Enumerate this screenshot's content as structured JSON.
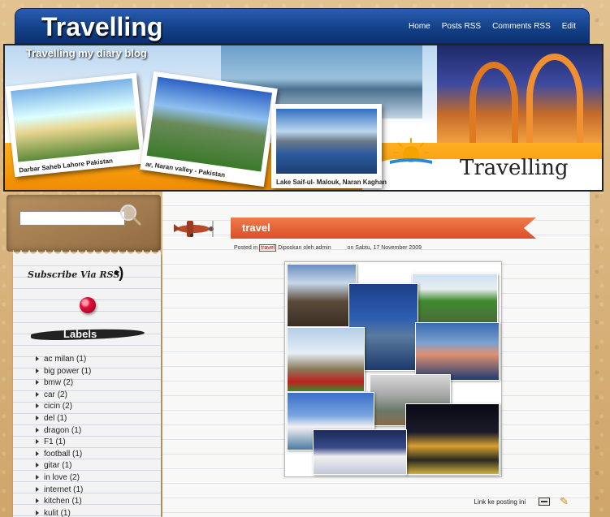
{
  "header": {
    "site_title": "Travelling",
    "nav": [
      "Home",
      "Posts RSS",
      "Comments RSS",
      "Edit"
    ]
  },
  "banner": {
    "tagline": "Travelling my diary blog",
    "word": "Travelling",
    "captions": [
      "Darbar Saheb Lahore Pakistan",
      "ar, Naran valley - Pakistan",
      "Lake Saif-ul- Malouk, Naran Kaghan"
    ]
  },
  "sidebar": {
    "search_value": "",
    "subscribe_text": "Subscribe Via RSS",
    "labels_title": "Labels",
    "labels": [
      {
        "name": "ac milan",
        "count": "(1)"
      },
      {
        "name": "big power",
        "count": "(1)"
      },
      {
        "name": "bmw",
        "count": "(2)"
      },
      {
        "name": "car",
        "count": "(2)"
      },
      {
        "name": "cicin",
        "count": "(2)"
      },
      {
        "name": "del",
        "count": "(1)"
      },
      {
        "name": "dragon",
        "count": "(1)"
      },
      {
        "name": "F1",
        "count": "(1)"
      },
      {
        "name": "football",
        "count": "(1)"
      },
      {
        "name": "gitar",
        "count": "(1)"
      },
      {
        "name": "in love",
        "count": "(2)"
      },
      {
        "name": "internet",
        "count": "(1)"
      },
      {
        "name": "kitchen",
        "count": "(1)"
      },
      {
        "name": "kulit",
        "count": "(1)"
      }
    ]
  },
  "post": {
    "title": "travel",
    "posted_in": "Posted in",
    "tag": "travel",
    "by": "Diposkan oleh admin",
    "date": "on Sabtu, 17 November 2009",
    "link_label": "Link ke posting ini"
  },
  "icons": {
    "search": "search-icon",
    "rss": "rss-icon",
    "pin": "pin-icon",
    "plane": "airplane-icon",
    "link": "link-icon",
    "edit": "pencil-icon"
  }
}
